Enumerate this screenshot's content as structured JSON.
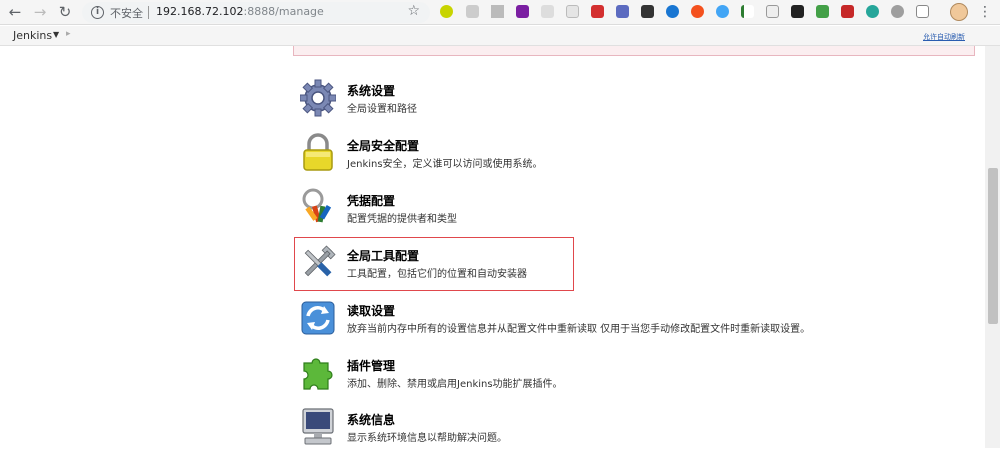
{
  "browser": {
    "security_label": "不安全",
    "url_host": "192.168.72.102",
    "url_rest": ":8888/manage"
  },
  "breadcrumb": {
    "root": "Jenkins",
    "autorefresh": "允许自动刷新"
  },
  "items": [
    {
      "title": "系统设置",
      "desc": "全局设置和路径",
      "icon": "gear-icon"
    },
    {
      "title": "全局安全配置",
      "desc": "Jenkins安全，定义谁可以访问或使用系统。",
      "icon": "lock-icon"
    },
    {
      "title": "凭据配置",
      "desc": "配置凭据的提供者和类型",
      "icon": "keys-icon"
    },
    {
      "title": "全局工具配置",
      "desc": "工具配置，包括它们的位置和自动安装器",
      "icon": "tools-icon"
    },
    {
      "title": "读取设置",
      "desc": "放弃当前内存中所有的设置信息并从配置文件中重新读取 仅用于当您手动修改配置文件时重新读取设置。",
      "icon": "reload-icon"
    },
    {
      "title": "插件管理",
      "desc": "添加、删除、禁用或启用Jenkins功能扩展插件。",
      "icon": "puzzle-icon"
    },
    {
      "title": "系统信息",
      "desc": "显示系统环境信息以帮助解决问题。",
      "icon": "computer-icon"
    }
  ],
  "colors": {
    "highlight_border": "#e0474c",
    "link": "#2a5db0"
  }
}
